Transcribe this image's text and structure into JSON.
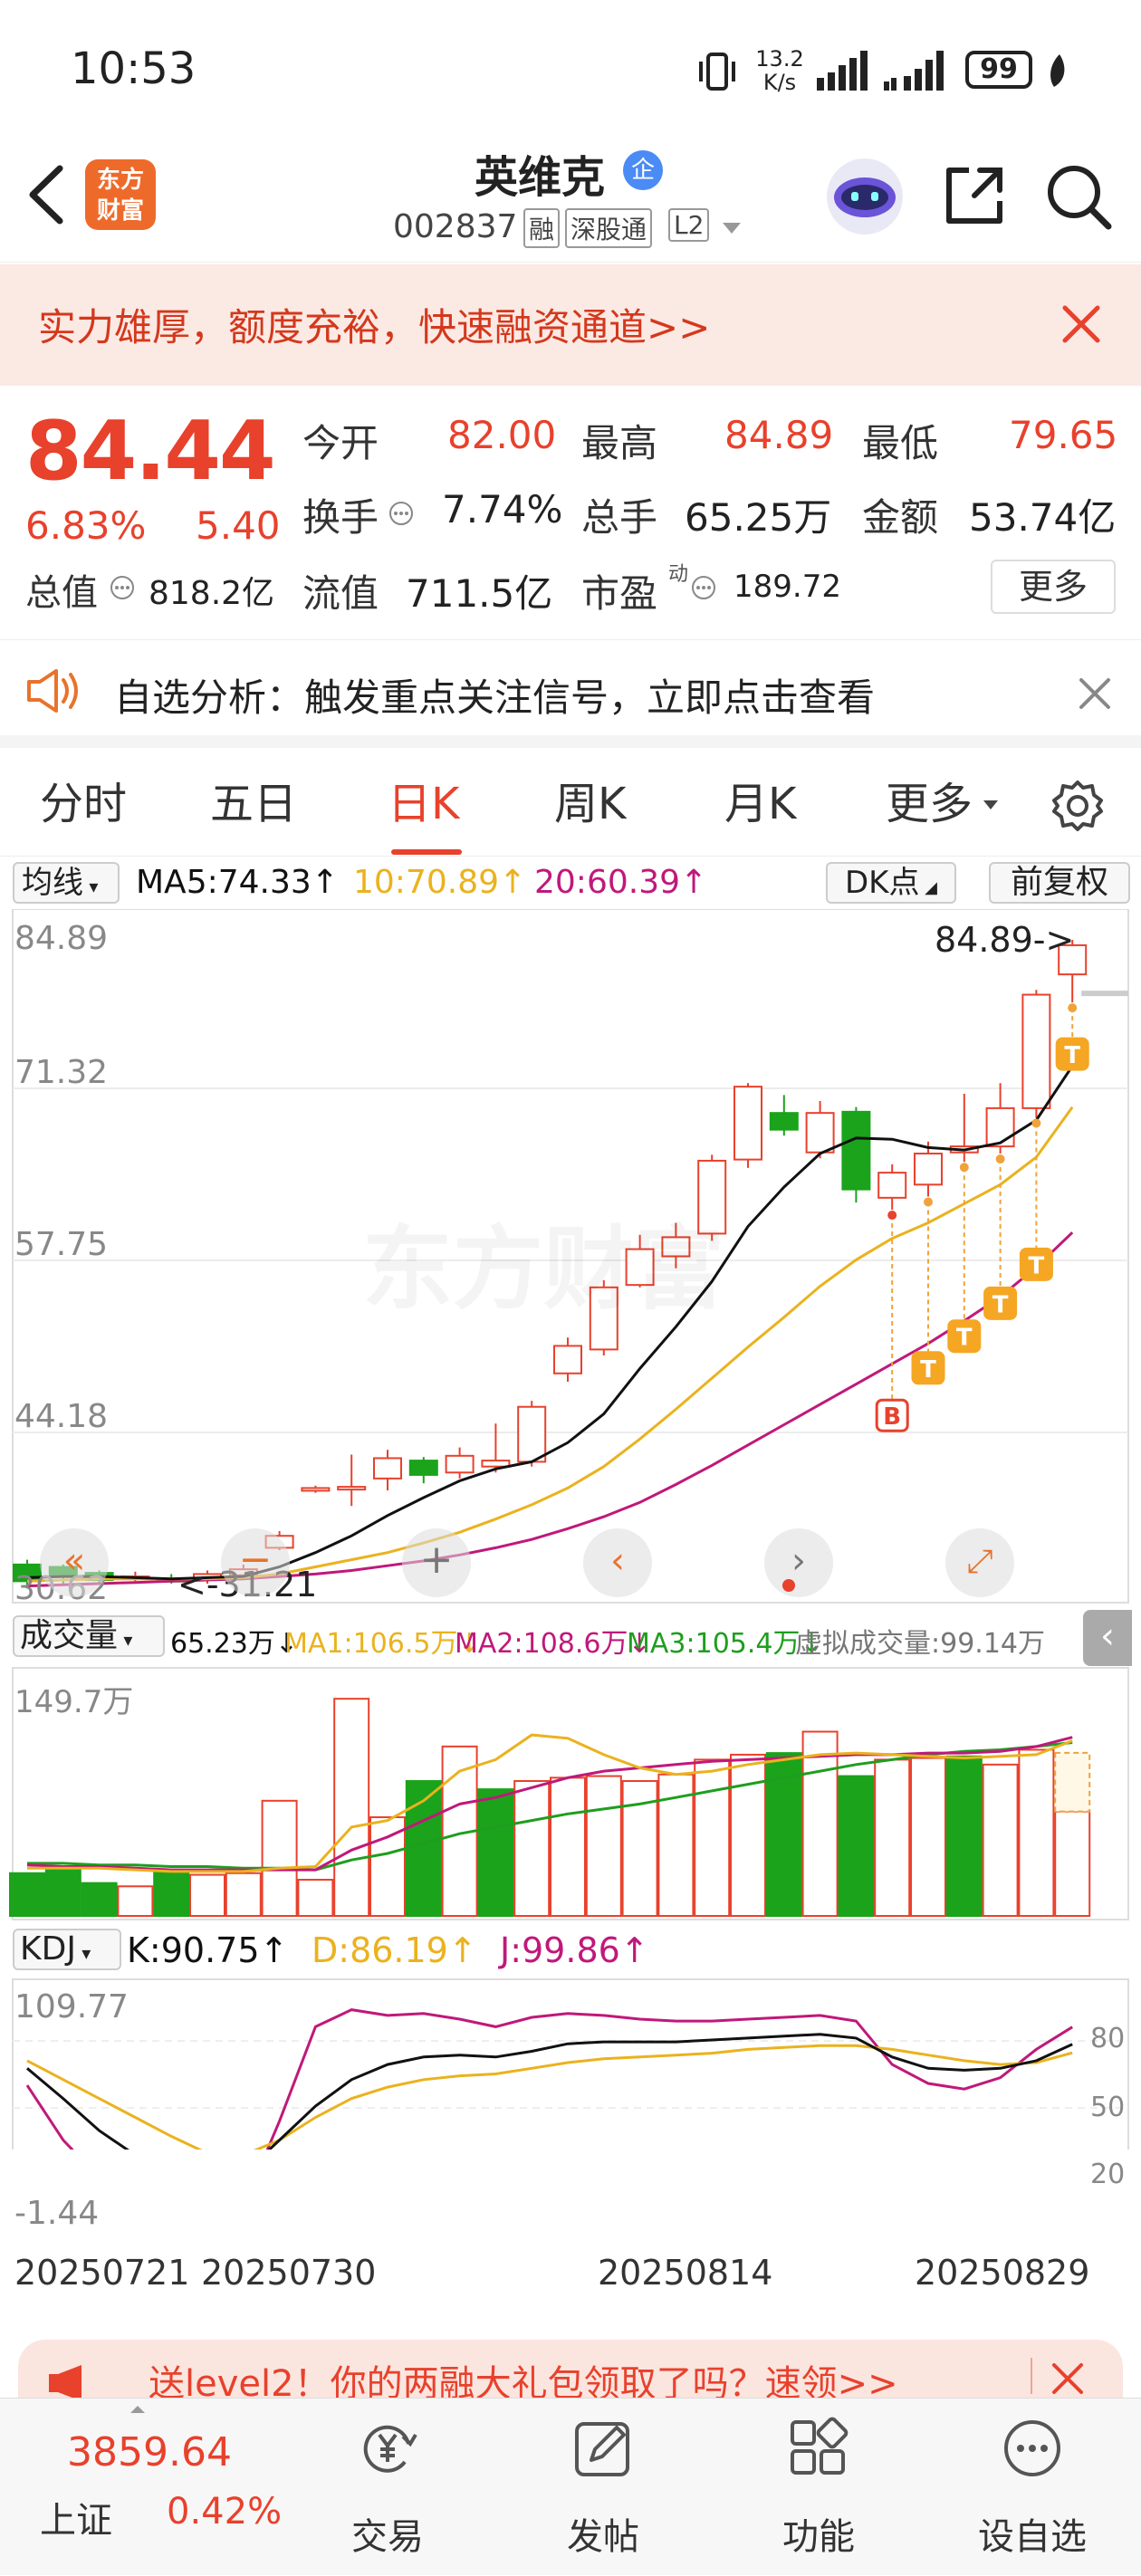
{
  "status": {
    "time": "10:53",
    "net_speed_top": "13.2",
    "net_speed_bottom": "K/s",
    "battery": "99"
  },
  "nav": {
    "logo_line1": "东方",
    "logo_line2": "财富",
    "stock_name": "英维克",
    "stock_badge": "企",
    "stock_code": "002837",
    "tag_margin": "融",
    "tag_connect": "深股通",
    "tag_level": "L2"
  },
  "banner": {
    "text": "实力雄厚，额度充裕，快速融资通道>>"
  },
  "quote": {
    "price": "84.44",
    "change_pct": "6.83%",
    "change": "5.40",
    "open_label": "今开",
    "open": "82.00",
    "high_label": "最高",
    "high": "84.89",
    "low_label": "最低",
    "low": "79.65",
    "turnover_label": "换手",
    "turnover": "7.74%",
    "volume_label": "总手",
    "volume": "65.25万",
    "amount_label": "金额",
    "amount": "53.74亿",
    "mktcap_label": "总值",
    "mktcap": "818.2亿",
    "float_label": "流值",
    "float": "711.5亿",
    "pe_label": "市盈",
    "pe_sup": "动",
    "pe": "189.72",
    "more_button": "更多"
  },
  "notice": {
    "text": "自选分析：触发重点关注信号，立即点击查看"
  },
  "tabs": [
    "分时",
    "五日",
    "日K",
    "周K",
    "月K",
    "更多"
  ],
  "active_tab": "日K",
  "ma_bar": {
    "selector": "均线",
    "ma5": "MA5:74.33↑",
    "ma10": "10:70.89↑",
    "ma20": "20:60.39↑",
    "dk_button": "DK点",
    "adjust_button": "前复权"
  },
  "kline": {
    "y_labels": [
      "84.89",
      "71.32",
      "57.75",
      "44.18",
      "30.62"
    ],
    "high_marker": "84.89->",
    "low_marker": "<-31.21",
    "watermark": "东方财富"
  },
  "vol_bar": {
    "selector": "成交量",
    "vol": "65.23万↓",
    "ma1": "MA1:106.5万↓",
    "ma2": "MA2:108.6万↓",
    "ma3": "MA3:105.4万↓",
    "virtual": "虚拟成交量:99.14万",
    "ymax": "149.7万"
  },
  "kdj_bar": {
    "selector": "KDJ",
    "k": "K:90.75↑",
    "d": "D:86.19↑",
    "j": "J:99.86↑",
    "ymax": "109.77",
    "ymin": "-1.44",
    "r80": "80",
    "r50": "50",
    "r20": "20"
  },
  "dates": [
    "20250721",
    "20250730",
    "20250814",
    "20250829"
  ],
  "promo": {
    "text": "送level2！你的两融大礼包领取了吗？速领>>"
  },
  "bottom": {
    "index_value": "3859.64",
    "index_name": "上证",
    "index_pct": "0.42%",
    "trade": "交易",
    "post": "发帖",
    "func": "功能",
    "watchlist": "设自选"
  },
  "colors": {
    "up": "#e8412c",
    "down": "#1ba31b",
    "ma5": "#111111",
    "ma10": "#eab21e",
    "ma20": "#c0187a",
    "ma3": "#1e9e1e"
  },
  "chart_data": {
    "type": "candlestick",
    "candles": [
      {
        "o": 31.2,
        "c": 32.6,
        "h": 33.0,
        "l": 30.6,
        "up": false
      },
      {
        "o": 32.4,
        "c": 31.6,
        "h": 32.6,
        "l": 30.8,
        "up": false
      },
      {
        "o": 31.9,
        "c": 31.3,
        "h": 32.1,
        "l": 31.0,
        "up": false
      },
      {
        "o": 31.5,
        "c": 31.6,
        "h": 32.0,
        "l": 31.2,
        "up": true
      },
      {
        "o": 31.4,
        "c": 31.2,
        "h": 31.8,
        "l": 31.0,
        "up": false
      },
      {
        "o": 31.3,
        "c": 31.8,
        "h": 32.1,
        "l": 31.0,
        "up": true
      },
      {
        "o": 31.7,
        "c": 32.2,
        "h": 32.6,
        "l": 31.4,
        "up": true
      },
      {
        "o": 34.0,
        "c": 35.0,
        "h": 35.4,
        "l": 33.8,
        "up": true
      },
      {
        "o": 38.8,
        "c": 39.0,
        "h": 39.2,
        "l": 38.6,
        "up": true
      },
      {
        "o": 38.9,
        "c": 39.1,
        "h": 41.8,
        "l": 37.5,
        "up": true
      },
      {
        "o": 39.8,
        "c": 41.5,
        "h": 42.2,
        "l": 38.8,
        "up": true
      },
      {
        "o": 41.3,
        "c": 40.1,
        "h": 41.6,
        "l": 39.4,
        "up": false
      },
      {
        "o": 40.3,
        "c": 41.7,
        "h": 42.4,
        "l": 39.8,
        "up": true
      },
      {
        "o": 40.8,
        "c": 41.3,
        "h": 44.4,
        "l": 40.3,
        "up": true
      },
      {
        "o": 41.2,
        "c": 45.8,
        "h": 46.3,
        "l": 40.8,
        "up": true
      },
      {
        "o": 48.6,
        "c": 50.9,
        "h": 51.6,
        "l": 47.9,
        "up": true
      },
      {
        "o": 50.6,
        "c": 55.8,
        "h": 56.4,
        "l": 50.1,
        "up": true
      },
      {
        "o": 56.0,
        "c": 59.0,
        "h": 60.2,
        "l": 55.8,
        "up": true
      },
      {
        "o": 58.4,
        "c": 60.0,
        "h": 61.2,
        "l": 57.4,
        "up": true
      },
      {
        "o": 60.3,
        "c": 66.4,
        "h": 66.9,
        "l": 59.7,
        "up": true
      },
      {
        "o": 66.5,
        "c": 72.6,
        "h": 72.9,
        "l": 65.8,
        "up": true
      },
      {
        "o": 70.4,
        "c": 69.0,
        "h": 71.9,
        "l": 68.5,
        "up": false
      },
      {
        "o": 67.1,
        "c": 70.4,
        "h": 71.4,
        "l": 66.6,
        "up": true
      },
      {
        "o": 70.5,
        "c": 64.0,
        "h": 70.9,
        "l": 62.9,
        "up": false
      },
      {
        "o": 63.3,
        "c": 65.4,
        "h": 66.1,
        "l": 62.3,
        "up": true
      },
      {
        "o": 64.4,
        "c": 67.0,
        "h": 68.0,
        "l": 63.4,
        "up": true
      },
      {
        "o": 67.1,
        "c": 67.6,
        "h": 72.0,
        "l": 66.3,
        "up": true
      },
      {
        "o": 67.6,
        "c": 70.8,
        "h": 72.9,
        "l": 67.0,
        "up": true
      },
      {
        "o": 70.8,
        "c": 80.3,
        "h": 80.7,
        "l": 70.0,
        "up": true
      },
      {
        "o": 82.0,
        "c": 84.44,
        "h": 84.89,
        "l": 79.65,
        "up": true
      }
    ],
    "ma5": [
      31.5,
      31.6,
      31.6,
      31.5,
      31.4,
      31.5,
      31.6,
      32.4,
      33.6,
      35.0,
      36.7,
      38.2,
      39.6,
      40.6,
      41.2,
      42.8,
      45.2,
      49.0,
      52.5,
      56.3,
      60.9,
      64.2,
      67.0,
      68.3,
      68.2,
      67.5,
      67.3,
      67.9,
      69.8,
      74.33
    ],
    "ma10": [
      31.2,
      31.3,
      31.4,
      31.4,
      31.4,
      31.4,
      31.5,
      31.8,
      32.4,
      33.0,
      33.6,
      34.4,
      35.3,
      36.4,
      37.6,
      39.0,
      40.8,
      43.1,
      45.6,
      48.2,
      50.8,
      53.3,
      55.9,
      58.1,
      59.9,
      61.2,
      62.8,
      64.4,
      66.7,
      70.89
    ],
    "ma20": [
      30.8,
      30.9,
      31.0,
      31.1,
      31.2,
      31.3,
      31.4,
      31.6,
      31.8,
      32.1,
      32.5,
      32.9,
      33.4,
      34.0,
      34.7,
      35.6,
      36.6,
      37.8,
      39.3,
      40.9,
      42.6,
      44.3,
      46.0,
      47.7,
      49.4,
      51.1,
      53.0,
      55.0,
      57.5,
      60.39
    ],
    "volume": [
      26,
      30,
      20,
      18,
      28,
      25,
      26,
      70,
      22,
      132,
      60,
      82,
      103,
      77,
      82,
      84,
      85,
      82,
      86,
      95,
      98,
      99,
      112,
      85,
      95,
      96,
      97,
      92,
      101,
      63.5
    ],
    "vol_up": [
      false,
      false,
      false,
      true,
      false,
      true,
      true,
      true,
      true,
      true,
      true,
      false,
      true,
      false,
      true,
      true,
      true,
      true,
      true,
      true,
      true,
      false,
      true,
      false,
      true,
      true,
      false,
      true,
      true,
      true
    ],
    "vol_ma1": [
      29,
      29,
      29,
      28,
      27,
      27,
      27,
      29,
      30,
      54,
      58,
      70,
      88,
      95,
      110,
      108,
      98,
      90,
      86,
      88,
      92,
      95,
      98,
      99,
      98,
      97,
      96,
      97,
      98,
      106.5
    ],
    "vol_ma2": [
      31,
      30,
      30,
      29,
      28,
      28,
      28,
      28,
      28,
      40,
      48,
      58,
      68,
      72,
      78,
      84,
      88,
      90,
      92,
      94,
      95,
      96,
      97,
      98,
      98,
      99,
      99,
      100,
      103,
      108.6
    ],
    "vol_ma3": [
      32,
      32,
      31,
      31,
      30,
      30,
      29,
      29,
      28,
      34,
      38,
      44,
      50,
      54,
      58,
      62,
      65,
      68,
      72,
      76,
      80,
      84,
      88,
      92,
      95,
      98,
      100,
      101,
      103,
      105.4
    ],
    "kdj_k": [
      78,
      62,
      45,
      32,
      21,
      14,
      22,
      40,
      58,
      72,
      80,
      84,
      85,
      84,
      87,
      91,
      92,
      92,
      92,
      93,
      94,
      95,
      96,
      94,
      84,
      78,
      77,
      78,
      82,
      90.75
    ],
    "kdj_d": [
      82,
      72,
      62,
      52,
      42,
      33,
      32,
      40,
      52,
      62,
      68,
      72,
      74,
      75,
      78,
      81,
      83,
      84,
      85,
      86,
      88,
      89,
      90,
      90,
      88,
      85,
      82,
      80,
      81,
      86.19
    ],
    "kdj_j": [
      69,
      40,
      20,
      -2,
      -20,
      -30,
      5,
      50,
      100,
      109,
      106,
      107,
      104,
      100,
      105,
      107,
      106,
      104,
      103,
      103,
      104,
      105,
      106,
      103,
      80,
      70,
      67,
      73,
      88,
      99.86
    ]
  }
}
